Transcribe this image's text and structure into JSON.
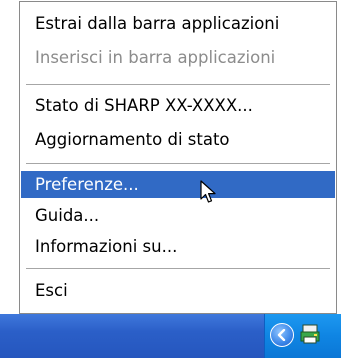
{
  "menu": {
    "items": [
      {
        "label": "Estrai dalla barra applicazioni",
        "disabled": false
      },
      {
        "label": "Inserisci in barra applicazioni",
        "disabled": true
      },
      {
        "label": "Stato di SHARP XX-XXXX...",
        "disabled": false
      },
      {
        "label": "Aggiornamento di stato",
        "disabled": false
      },
      {
        "label": "Preferenze...",
        "disabled": false,
        "selected": true
      },
      {
        "label": "Guida...",
        "disabled": false
      },
      {
        "label": "Informazioni su...",
        "disabled": false
      },
      {
        "label": "Esci",
        "disabled": false
      }
    ]
  },
  "colors": {
    "selection": "#316ac5",
    "taskbar": "#2b5fc8",
    "tray": "#0f85e3"
  },
  "taskbar": {
    "tray_icons": [
      "show-hidden-icons-chevron-icon",
      "printer-status-icon"
    ]
  }
}
